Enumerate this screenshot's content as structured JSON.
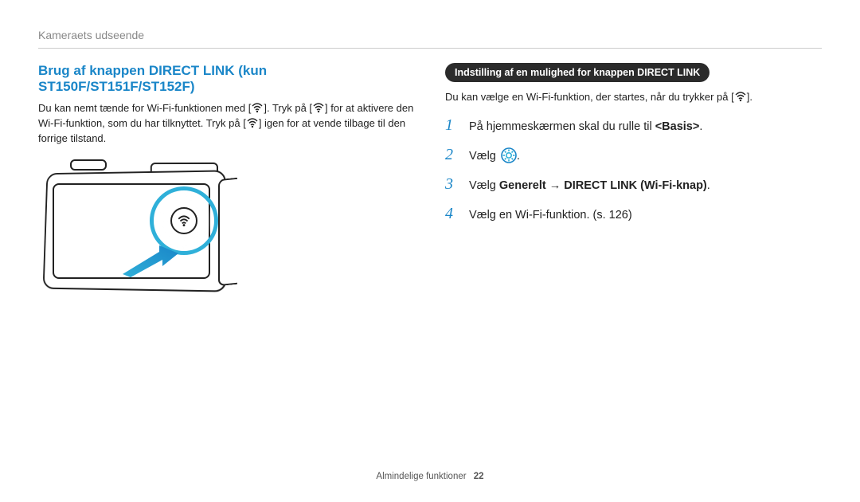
{
  "breadcrumb": "Kameraets udseende",
  "left": {
    "title": "Brug af knappen DIRECT LINK (kun ST150F/ST151F/ST152F)",
    "para_segments": [
      "Du kan nemt tænde for Wi-Fi-funktionen med [",
      "]. Tryk på [",
      "] for at aktivere den Wi-Fi-funktion, som du har tilknyttet. Tryk på [",
      "] igen for at vende tilbage til den forrige tilstand."
    ]
  },
  "right": {
    "pill": "Indstilling af en mulighed for knappen DIRECT LINK",
    "intro_segments": [
      "Du kan vælge en Wi-Fi-funktion, der startes, når du trykker på [",
      "]."
    ],
    "steps": [
      {
        "n": "1",
        "pre": "På hjemmeskærmen skal du rulle til ",
        "bold": "<Basis>",
        "post": "."
      },
      {
        "n": "2",
        "pre": "Vælg ",
        "gear": true,
        "post": "."
      },
      {
        "n": "3",
        "pre": "Vælg ",
        "bold": "Generelt → DIRECT LINK (Wi-Fi-knap)",
        "post": "."
      },
      {
        "n": "4",
        "pre": "Vælg en Wi-Fi-funktion. (s. 126)"
      }
    ]
  },
  "footer": {
    "label": "Almindelige funktioner",
    "page": "22"
  }
}
